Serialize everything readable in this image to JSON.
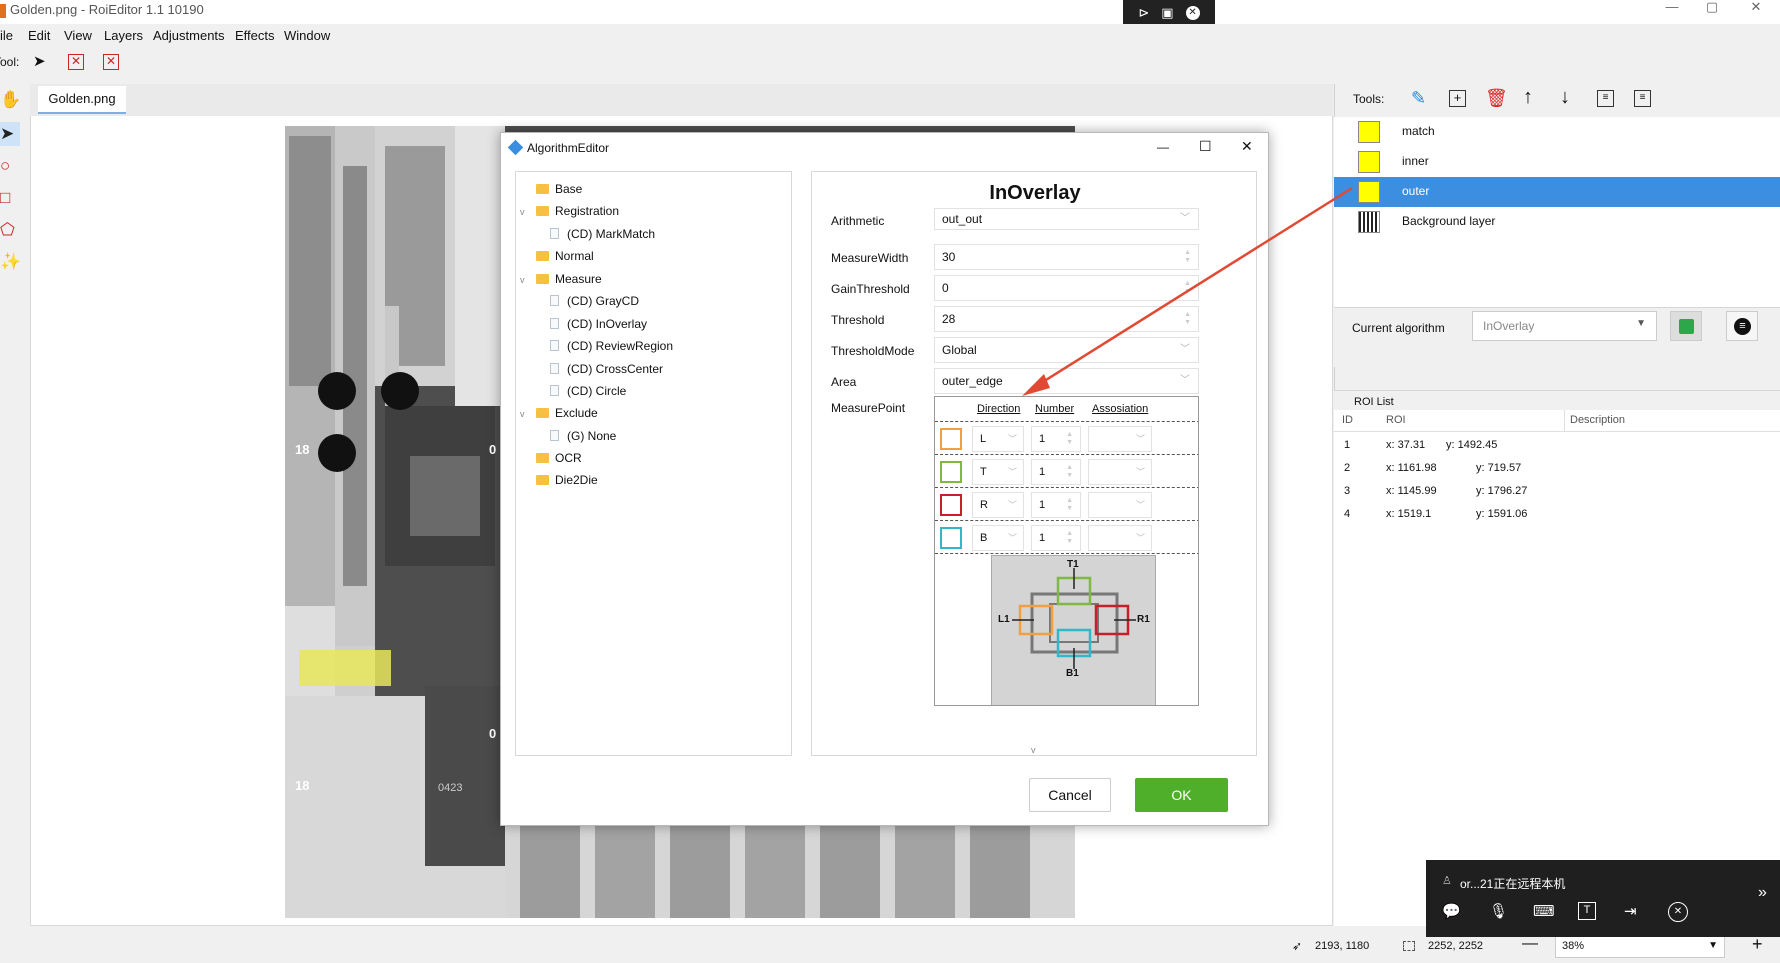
{
  "window": {
    "title": "Golden.png - RoiEditor 1.1 10190",
    "min_label": "—",
    "max_label": "▢",
    "close_label": "✕"
  },
  "remote_toolbar": {
    "icons": [
      "pin-icon",
      "screen-icon",
      "close-icon"
    ]
  },
  "menu": [
    "File",
    "Edit",
    "View",
    "Layers",
    "Adjustments",
    "Effects",
    "Window"
  ],
  "toolrow": {
    "label": "Tool:"
  },
  "doc": {
    "tab": "Golden.png"
  },
  "image_text": {
    "a": "18",
    "b": "18",
    "c": "0423",
    "d": "0",
    "e": "0"
  },
  "right": {
    "tools_label": "Tools:",
    "layers": [
      {
        "name": "match",
        "selected": false
      },
      {
        "name": "inner",
        "selected": false
      },
      {
        "name": "outer",
        "selected": true
      },
      {
        "name": "Background layer",
        "selected": false
      }
    ],
    "current_algorithm_label": "Current algorithm",
    "current_algorithm_value": "InOverlay",
    "roi_list_label": "ROI List",
    "roi_headers": [
      "ID",
      "ROI",
      "Description"
    ],
    "roi_rows": [
      {
        "id": "1",
        "x": "x: 37.31",
        "y": "y: 1492.45"
      },
      {
        "id": "2",
        "x": "x: 1161.98",
        "y": "y: 719.57"
      },
      {
        "id": "3",
        "x": "x: 1145.99",
        "y": "y: 1796.27"
      },
      {
        "id": "4",
        "x": "x: 1519.1",
        "y": "y: 1591.06"
      }
    ]
  },
  "dialog": {
    "title": "AlgorithmEditor",
    "min": "—",
    "max": "☐",
    "close": "✕",
    "tree": [
      {
        "label": "Base",
        "type": "folder",
        "level": 0,
        "caret": ""
      },
      {
        "label": "Registration",
        "type": "folder",
        "level": 0,
        "caret": "v"
      },
      {
        "label": "(CD) MarkMatch",
        "type": "file",
        "level": 1,
        "caret": ""
      },
      {
        "label": "Normal",
        "type": "folder",
        "level": 0,
        "caret": ""
      },
      {
        "label": "Measure",
        "type": "folder",
        "level": 0,
        "caret": "v"
      },
      {
        "label": "(CD) GrayCD",
        "type": "file",
        "level": 1,
        "caret": ""
      },
      {
        "label": "(CD) InOverlay",
        "type": "file",
        "level": 1,
        "caret": ""
      },
      {
        "label": "(CD) ReviewRegion",
        "type": "file",
        "level": 1,
        "caret": ""
      },
      {
        "label": "(CD) CrossCenter",
        "type": "file",
        "level": 1,
        "caret": ""
      },
      {
        "label": "(CD) Circle",
        "type": "file",
        "level": 1,
        "caret": ""
      },
      {
        "label": "Exclude",
        "type": "folder",
        "level": 0,
        "caret": "v"
      },
      {
        "label": "(G) None",
        "type": "file",
        "level": 1,
        "caret": ""
      },
      {
        "label": "OCR",
        "type": "folder",
        "level": 0,
        "caret": ""
      },
      {
        "label": "Die2Die",
        "type": "folder",
        "level": 0,
        "caret": ""
      }
    ],
    "heading": "InOverlay",
    "props": {
      "arithmetic_label": "Arithmetic",
      "arithmetic_value": "out_out",
      "measurewidth_label": "MeasureWidth",
      "measurewidth_value": "30",
      "gainthreshold_label": "GainThreshold",
      "gainthreshold_value": "0",
      "threshold_label": "Threshold",
      "threshold_value": "28",
      "thresholdmode_label": "ThresholdMode",
      "thresholdmode_value": "Global",
      "area_label": "Area",
      "area_value": "outer_edge",
      "measurepoint_label": "MeasurePoint"
    },
    "mp_headers": [
      "Direction",
      "Number",
      "Assosiation"
    ],
    "mp_rows": [
      {
        "color": "#f0a040",
        "dir": "L",
        "num": "1"
      },
      {
        "color": "#80b840",
        "dir": "T",
        "num": "1"
      },
      {
        "color": "#c8202a",
        "dir": "R",
        "num": "1"
      },
      {
        "color": "#30b8c8",
        "dir": "B",
        "num": "1"
      }
    ],
    "diagram": {
      "t": "T1",
      "l": "L1",
      "r": "R1",
      "b": "B1"
    },
    "cancel": "Cancel",
    "ok": "OK"
  },
  "status": {
    "cursor": "2193, 1180",
    "size": "2252, 2252",
    "zoom": "38%"
  },
  "remote": {
    "text": "or...21正在远程本机"
  }
}
